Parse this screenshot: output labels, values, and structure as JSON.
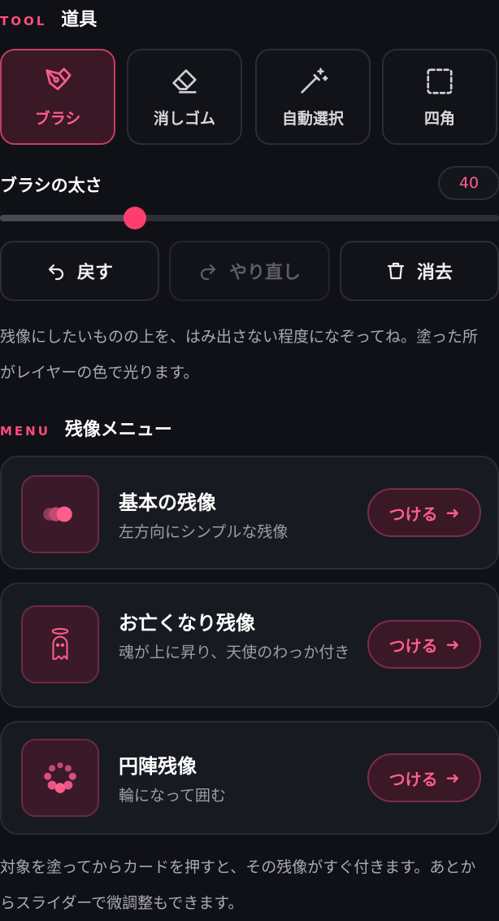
{
  "tool_section": {
    "kicker": "TOOL",
    "title": "道具"
  },
  "tools": [
    {
      "label": "ブラシ",
      "icon": "brush-icon",
      "active": true
    },
    {
      "label": "消しゴム",
      "icon": "eraser-icon",
      "active": false
    },
    {
      "label": "自動選択",
      "icon": "magic-wand-icon",
      "active": false
    },
    {
      "label": "四角",
      "icon": "rect-select-icon",
      "active": false
    }
  ],
  "brush_size": {
    "label": "ブラシの太さ",
    "value": "40",
    "fraction": 0.27
  },
  "actions": {
    "undo": "戻す",
    "redo": "やり直し",
    "clear": "消去"
  },
  "hint_top": "残像にしたいものの上を、はみ出さない程度になぞってね。塗った所がレイヤーの色で光ります。",
  "menu_section": {
    "kicker": "MENU",
    "title": "残像メニュー"
  },
  "menu_items": [
    {
      "title": "基本の残像",
      "desc": "左方向にシンプルな残像",
      "button": "つける",
      "icon": "trail-dots-icon"
    },
    {
      "title": "お亡くなり残像",
      "desc": "魂が上に昇り、天使のわっか付き",
      "button": "つける",
      "icon": "ghost-halo-icon"
    },
    {
      "title": "円陣残像",
      "desc": "輪になって囲む",
      "button": "つける",
      "icon": "circle-dots-icon"
    }
  ],
  "hint_bottom": "対象を塗ってからカードを押すと、その残像がすぐ付きます。あとからスライダーで微調整もできます。",
  "colors": {
    "accent": "#ff3d6e",
    "background": "#101116",
    "card": "#181a21"
  }
}
